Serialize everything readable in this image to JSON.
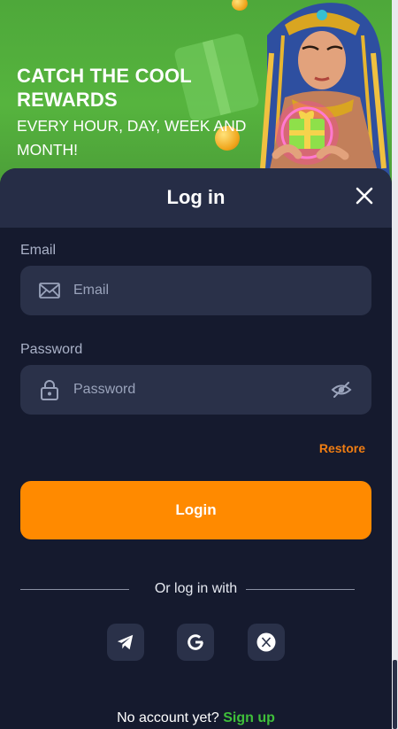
{
  "banner": {
    "headline": "CATCH THE COOL REWARDS",
    "subline": "EVERY HOUR, DAY, WEEK AND MONTH!"
  },
  "modal": {
    "title": "Log in",
    "close_icon": "close-icon"
  },
  "email": {
    "label": "Email",
    "placeholder": "Email",
    "value": "",
    "icon": "envelope-icon"
  },
  "password": {
    "label": "Password",
    "placeholder": "Password",
    "value": "",
    "icon": "lock-icon",
    "toggle_icon": "eye-off-icon"
  },
  "restore_link": "Restore",
  "login_button": "Login",
  "divider_text": "Or log in with",
  "social": [
    {
      "name": "telegram",
      "icon": "telegram-icon"
    },
    {
      "name": "google",
      "icon": "google-icon"
    },
    {
      "name": "x",
      "icon": "x-icon"
    }
  ],
  "footer": {
    "prompt": "No account yet?",
    "signup": "Sign up"
  },
  "colors": {
    "accent": "#ff8a00",
    "restore": "#f07d12",
    "signup": "#3fbf3a",
    "background": "#151a2e",
    "field": "#2a3149",
    "header": "#262d46",
    "banner": "#56b43e"
  }
}
